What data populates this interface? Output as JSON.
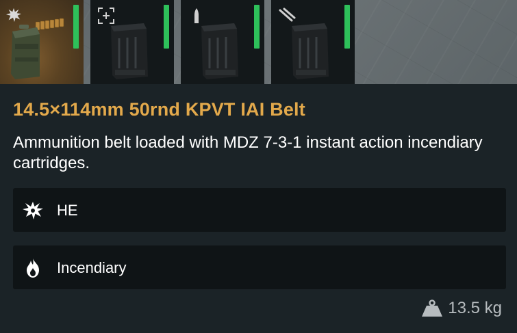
{
  "slots": [
    {
      "name": "slot-1",
      "selected": true,
      "mode_icon": "explosion-icon",
      "item_icon": "ammo-box-belt-icon",
      "indicator_color": "#2ec05a"
    },
    {
      "name": "slot-2",
      "selected": false,
      "mode_icon": "target-bracket-icon",
      "item_icon": "magazine-icon",
      "indicator_color": "#2ec05a"
    },
    {
      "name": "slot-3",
      "selected": false,
      "mode_icon": "single-bullet-icon",
      "item_icon": "magazine-icon",
      "indicator_color": "#2ec05a"
    },
    {
      "name": "slot-4",
      "selected": false,
      "mode_icon": "twin-barrel-icon",
      "item_icon": "magazine-icon",
      "indicator_color": "#2ec05a"
    }
  ],
  "item": {
    "title": "14.5×114mm 50rnd KPVT IAI Belt",
    "description": "Ammunition belt loaded with MDZ 7-3-1 instant action incendiary cartridges."
  },
  "properties": [
    {
      "icon": "explosion-icon",
      "label": "HE"
    },
    {
      "icon": "flame-icon",
      "label": "Incendiary"
    }
  ],
  "weight": {
    "icon": "weight-icon",
    "value": "13.5 kg"
  },
  "colors": {
    "title": "#e3a94b",
    "indicator": "#2ec05a",
    "panel_bg": "#1b2327",
    "property_bg": "#0f1416"
  }
}
